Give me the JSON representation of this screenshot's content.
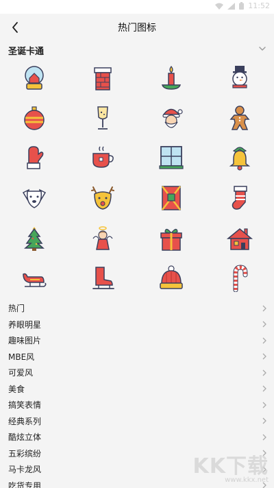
{
  "status_bar": {
    "time": "11:52"
  },
  "nav": {
    "title": "热门图标"
  },
  "section": {
    "title": "圣诞卡通"
  },
  "icons": [
    "snow-globe-icon",
    "chimney-icon",
    "candle-icon",
    "snowman-icon",
    "ornament-ball-icon",
    "champagne-glass-icon",
    "santa-claus-icon",
    "gingerbread-man-icon",
    "mitten-icon",
    "hot-tea-cup-icon",
    "window-icon",
    "christmas-bell-icon",
    "dog-face-icon",
    "reindeer-face-icon",
    "gift-card-icon",
    "christmas-stocking-icon",
    "christmas-tree-icon",
    "angel-icon",
    "gift-box-icon",
    "house-icon",
    "sleigh-icon",
    "ice-skate-icon",
    "knit-hat-icon",
    "candy-cane-icon"
  ],
  "categories": [
    "热门",
    "养眼明星",
    "趣味图片",
    "MBE风",
    "可爱风",
    "美食",
    "搞笑表情",
    "经典系列",
    "酷炫立体",
    "五彩缤纷",
    "马卡龙风",
    "吃货专用"
  ],
  "watermark": {
    "main": "KK下载",
    "url": "www.kkx.net"
  },
  "colors": {
    "background": "#f4f4f4",
    "red": "#e7514b",
    "green": "#47a65a",
    "yellow": "#f5c33b",
    "outline": "#3a3f5c"
  }
}
